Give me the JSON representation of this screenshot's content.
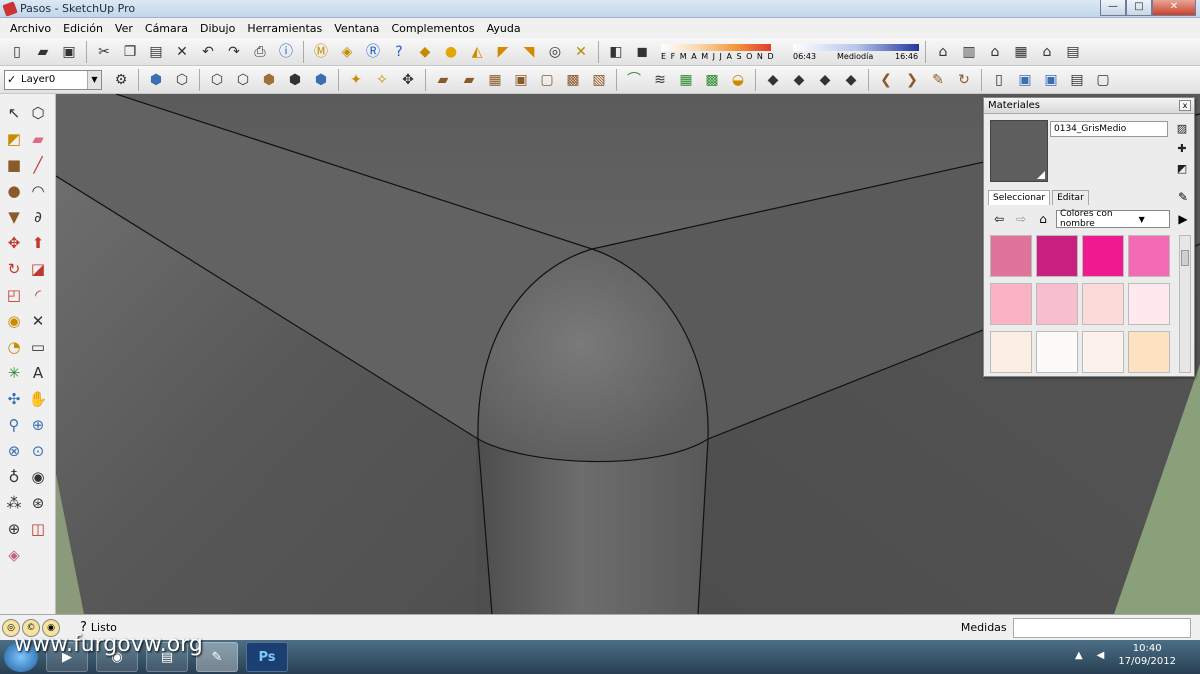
{
  "window": {
    "title": "Pasos - SketchUp Pro",
    "btn_min": "—",
    "btn_max": "□",
    "btn_close": "✕"
  },
  "menu": [
    "Archivo",
    "Edición",
    "Ver",
    "Cámara",
    "Dibujo",
    "Herramientas",
    "Ventana",
    "Complementos",
    "Ayuda"
  ],
  "toolbar1": {
    "group1": [
      "new-icon",
      "open-icon",
      "save-icon"
    ],
    "group2": [
      "cut-icon",
      "copy-icon",
      "paste-icon",
      "erase-icon",
      "undo-icon",
      "redo-icon",
      "print-icon",
      "model-info-icon"
    ],
    "group3": [
      "material-m-icon",
      "tag-icon",
      "render-icon",
      "help-icon",
      "layer-tag-icon",
      "sphere-icon",
      "tool-a-icon",
      "tool-b-icon",
      "tool-c-icon",
      "tool-d-icon",
      "tool-e-icon"
    ],
    "shadow": {
      "months": "E F M A M J J A S O N D",
      "time_start": "06:43",
      "time_mid": "Mediodía",
      "time_end": "16:46"
    },
    "group4": [
      "house-iso-icon",
      "house-front-icon",
      "house-top-icon",
      "house-side-icon",
      "house-back-icon",
      "house-left-icon"
    ]
  },
  "toolbar2": {
    "layer": {
      "check": "✓",
      "name": "Layer0",
      "arrow": "▼"
    },
    "icons": [
      "layer-manager-icon",
      "xray-icon",
      "wireframe-icon",
      "hidden-line-icon",
      "shaded-icon",
      "shaded-texture-icon",
      "monochrome-icon",
      "section-icon",
      "walk-icon",
      "look-icon",
      "position-camera-icon",
      "terrain-a-icon",
      "terrain-b-icon",
      "terrain-c-icon",
      "terrain-d-icon",
      "terrain-e-icon",
      "terrain-f-icon",
      "terrain-g-icon",
      "arc-tool-icon",
      "cloth-icon",
      "grid-icon",
      "grid2-icon",
      "sandbox-icon",
      "plane-a-icon",
      "plane-b-icon",
      "plane-c-icon",
      "plane-d-icon",
      "arrow-tool-icon",
      "knife-icon",
      "pen-icon",
      "rotate-tool-icon",
      "door-a-icon",
      "door-b-icon",
      "door-c-icon",
      "door-d-icon",
      "door-e-icon"
    ]
  },
  "left_tools": [
    [
      "select-icon",
      "component-icon"
    ],
    [
      "paint-icon",
      "eraser-icon"
    ],
    [
      "rectangle-icon",
      "line-icon"
    ],
    [
      "circle-icon",
      "arc-icon"
    ],
    [
      "polygon-icon",
      "freehand-icon"
    ],
    [
      "move-icon",
      "pushpull-icon"
    ],
    [
      "rotate-icon",
      "followme-icon"
    ],
    [
      "scale-icon",
      "offset-icon"
    ],
    [
      "tape-icon",
      "dimension-icon"
    ],
    [
      "protractor-icon",
      "text-icon"
    ],
    [
      "axes-icon",
      "3dtext-icon"
    ],
    [
      "orbit-icon",
      "pan-icon"
    ],
    [
      "zoom-icon",
      "zoom-window-icon"
    ],
    [
      "zoom-extents-icon",
      "previous-icon"
    ],
    [
      "position-icon",
      "lookaround-icon"
    ],
    [
      "walk-icon2",
      "section-plane-icon"
    ],
    [
      "compass-icon",
      "sketch-icon"
    ],
    [
      "photo-match-icon"
    ]
  ],
  "materials": {
    "title": "Materiales",
    "close": "x",
    "name": "0134_GrisMedio",
    "tab_select": "Seleccionar",
    "tab_edit": "Editar",
    "collection": "Colores con nombre",
    "collection_arrow": "▼",
    "current_color": "#5e5e5e",
    "swatches": [
      "#e0739a",
      "#c8207f",
      "#f01a8f",
      "#f56ab4",
      "#f9b3c4",
      "#f7bfcd",
      "#fbdada",
      "#fde9ee",
      "#fbeee2",
      "#fdfbfa",
      "#fdf1ec",
      "#fde2c2"
    ]
  },
  "status": {
    "text": "Listo",
    "measure_label": "Medidas"
  },
  "taskbar": {
    "ps_label": "Ps",
    "watermark": "www.furgovw.org",
    "time": "10:40",
    "date": "17/09/2012"
  }
}
